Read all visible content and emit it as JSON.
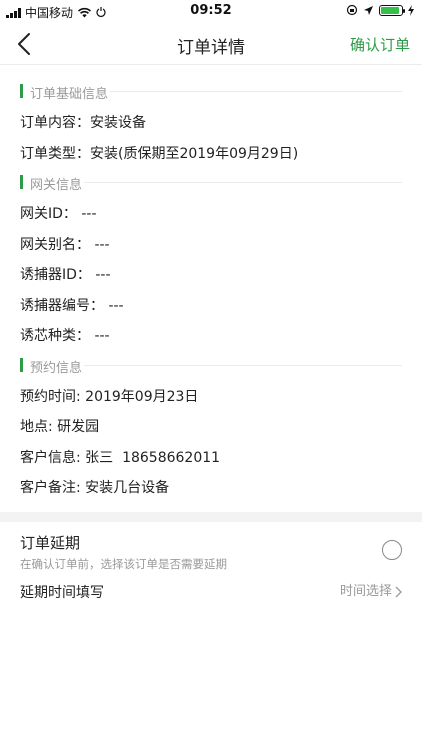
{
  "status_bar": {
    "carrier": "中国移动",
    "time": "09:52"
  },
  "nav": {
    "title": "订单详情",
    "action": "确认订单"
  },
  "sections": {
    "basic": {
      "title": "订单基础信息",
      "rows": [
        {
          "label": "订单内容：",
          "value": "安装设备"
        },
        {
          "label": "订单类型：",
          "value": "安装(质保期至2019年09月29日)"
        }
      ]
    },
    "gateway": {
      "title": "网关信息",
      "rows": [
        {
          "label": "网关ID：",
          "value": "---"
        },
        {
          "label": "网关别名：",
          "value": "---"
        },
        {
          "label": "诱捕器ID：",
          "value": "---"
        },
        {
          "label": "诱捕器编号：",
          "value": "---"
        },
        {
          "label": "诱芯种类：",
          "value": "---"
        }
      ]
    },
    "appointment": {
      "title": "预约信息",
      "rows": [
        {
          "label": "预约时间: ",
          "value": "2019年09月23日"
        },
        {
          "label": "地点: ",
          "value": "研发园"
        },
        {
          "label": "客户信息: ",
          "value": "张三  18658662011"
        },
        {
          "label": "客户备注: ",
          "value": "安装几台设备"
        }
      ]
    }
  },
  "delay": {
    "title": "订单延期",
    "subtitle": "在确认订单前，选择该订单是否需要延期",
    "checked": false
  },
  "delay_time": {
    "label": "延期时间填写",
    "picker": "时间选择"
  },
  "colors": {
    "accent": "#2e9b47",
    "muted": "#9a9a9a"
  }
}
